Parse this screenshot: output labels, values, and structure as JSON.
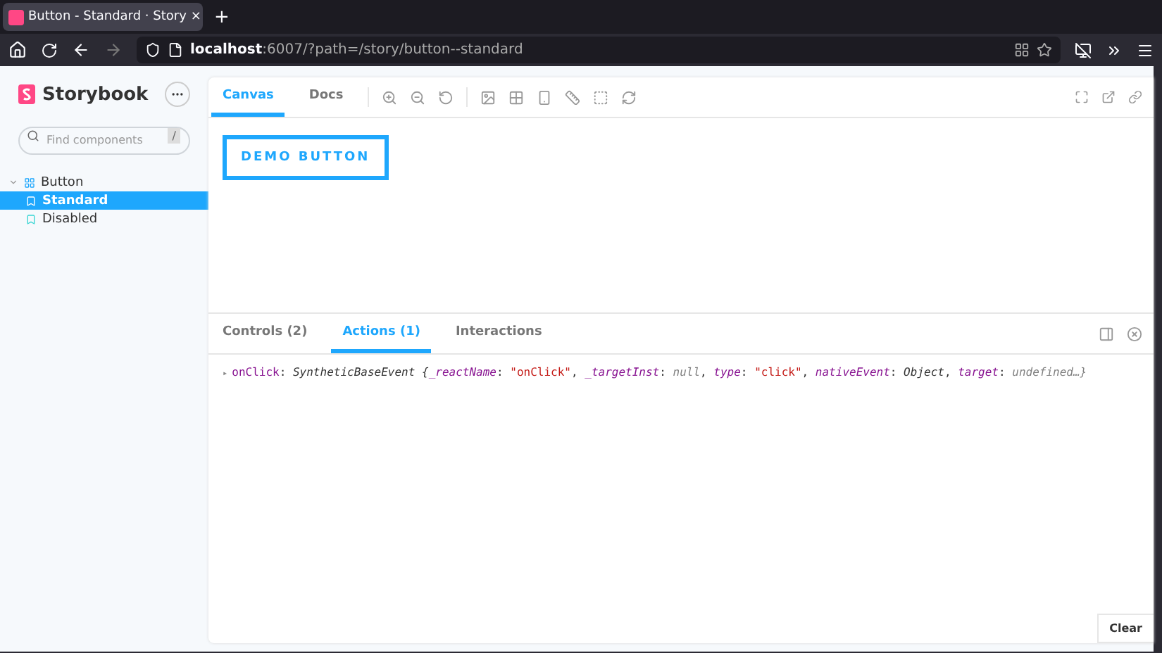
{
  "browser": {
    "tab_title": "Button - Standard · Story",
    "tab_close": "×",
    "new_tab": "+",
    "url_host": "localhost",
    "url_rest": ":6007/?path=/story/button--standard"
  },
  "sidebar": {
    "brand": "Storybook",
    "search": {
      "placeholder": "Find components",
      "shortcut": "/"
    },
    "tree": [
      {
        "label": "Button",
        "expanded": true,
        "children": [
          {
            "label": "Standard",
            "selected": true
          },
          {
            "label": "Disabled",
            "selected": false
          }
        ]
      }
    ]
  },
  "canvas_tabs": [
    {
      "label": "Canvas",
      "selected": true
    },
    {
      "label": "Docs",
      "selected": false
    }
  ],
  "demo_button": "DEMO BUTTON",
  "addon_tabs": [
    {
      "label": "Controls (2)",
      "selected": false
    },
    {
      "label": "Actions (1)",
      "selected": true
    },
    {
      "label": "Interactions",
      "selected": false
    }
  ],
  "log_marker": "▸",
  "log": [
    {
      "kind": "key",
      "text": "onClick"
    },
    {
      "kind": "plain",
      "text": ": "
    },
    {
      "kind": "class",
      "text": "SyntheticBaseEvent {"
    },
    {
      "kind": "prop",
      "text": "_reactName"
    },
    {
      "kind": "plain",
      "text": ": "
    },
    {
      "kind": "string",
      "text": "\"onClick\""
    },
    {
      "kind": "plain",
      "text": ", "
    },
    {
      "kind": "prop",
      "text": "_targetInst"
    },
    {
      "kind": "plain",
      "text": ": "
    },
    {
      "kind": "null",
      "text": "null"
    },
    {
      "kind": "plain",
      "text": ", "
    },
    {
      "kind": "prop",
      "text": "type"
    },
    {
      "kind": "plain",
      "text": ": "
    },
    {
      "kind": "string",
      "text": "\"click\""
    },
    {
      "kind": "plain",
      "text": ", "
    },
    {
      "kind": "prop",
      "text": "nativeEvent"
    },
    {
      "kind": "plain",
      "text": ": "
    },
    {
      "kind": "class",
      "text": "Object"
    },
    {
      "kind": "plain",
      "text": ", "
    },
    {
      "kind": "prop",
      "text": "target"
    },
    {
      "kind": "plain",
      "text": ": "
    },
    {
      "kind": "null",
      "text": "undefined…}"
    }
  ],
  "clear_button": "Clear"
}
